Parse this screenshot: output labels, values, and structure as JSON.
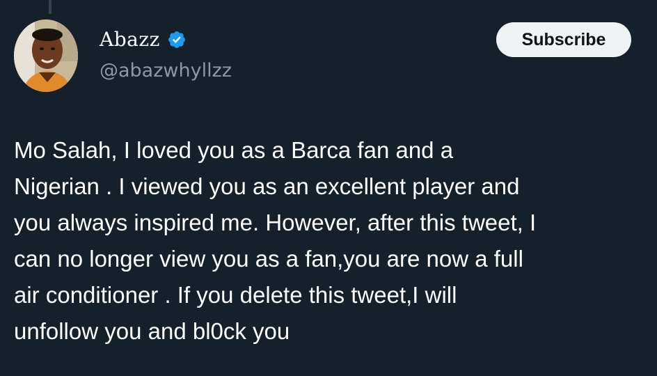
{
  "author": {
    "display_name": "Abazz",
    "handle": "@abazwhyllzz",
    "verified": true,
    "verified_color": "#1d9bf0"
  },
  "header": {
    "subscribe_label": "Subscribe"
  },
  "tweet": {
    "lines": [
      "Mo Salah, I loved you as a Barca fan and a",
      "Nigerian . I viewed you as an excellent player and",
      "you always inspired me. However, after this tweet, I",
      "can no longer view you as a fan,you are now a full",
      "air conditioner . If you delete this tweet,I will",
      "unfollow you and bl0ck you"
    ]
  },
  "theme": {
    "background": "#15202b",
    "text": "#ffffff",
    "muted": "#8b98a5",
    "button_bg": "#eff3f4",
    "button_text": "#0f1419"
  },
  "icons": {
    "verified": "verified-badge-icon",
    "avatar": "user-avatar"
  }
}
